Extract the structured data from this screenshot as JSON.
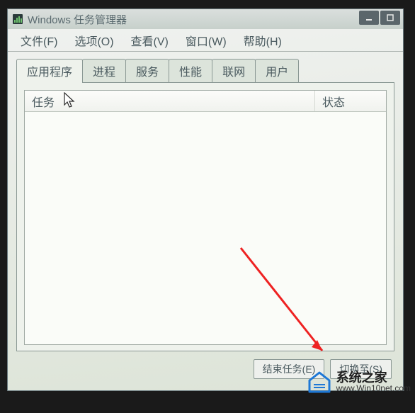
{
  "window": {
    "title": "Windows 任务管理器"
  },
  "menu": {
    "file": "文件(F)",
    "options": "选项(O)",
    "view": "查看(V)",
    "windows": "窗口(W)",
    "help": "帮助(H)"
  },
  "tabs": {
    "applications": "应用程序",
    "processes": "进程",
    "services": "服务",
    "performance": "性能",
    "network": "联网",
    "users": "用户"
  },
  "columns": {
    "task": "任务",
    "status": "状态"
  },
  "buttons": {
    "end_task": "结束任务(E)",
    "switch_to": "切换至(S)"
  },
  "watermark": {
    "title": "系统之家",
    "url": "www.Win10net.com"
  }
}
